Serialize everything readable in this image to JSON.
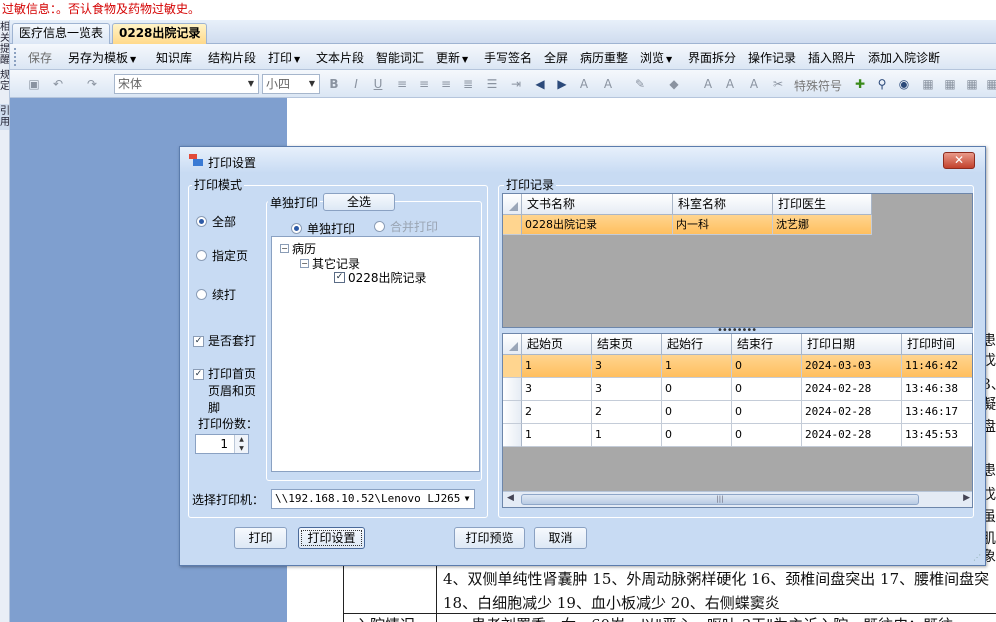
{
  "allergy_banner": "过敏信息：。否认食物及药物过敏史。",
  "left_strip": {
    "tab1": "相关提醒",
    "tab2": "规定",
    "tab3": "引用"
  },
  "doc_tabs": [
    "医疗信息一览表",
    "0228出院记录"
  ],
  "menubar": {
    "items": [
      {
        "label": "保存",
        "disabled": true
      },
      {
        "label": "另存为模板",
        "dropdown": true
      },
      {
        "label": "知识库"
      },
      {
        "label": "结构片段"
      },
      {
        "label": "打印",
        "dropdown": true
      },
      {
        "label": "文本片段"
      },
      {
        "label": "智能词汇"
      },
      {
        "label": "更新",
        "dropdown": true
      },
      {
        "label": "手写签名"
      },
      {
        "label": "全屏"
      },
      {
        "label": "病历重整"
      },
      {
        "label": "浏览",
        "dropdown": true
      },
      {
        "label": "界面拆分"
      },
      {
        "label": "操作记录"
      },
      {
        "label": "插入照片"
      },
      {
        "label": "添加入院诊断"
      }
    ]
  },
  "toolbar": {
    "font_name": "宋体",
    "font_size": "小四",
    "special_symbol": "特殊符号"
  },
  "document": {
    "line1": "4、双侧单纯性肾囊肿 15、外周动脉粥样硬化 16、颈椎间盘突出 17、腰椎间盘突",
    "line2": "18、白细胞减少 19、血小板减少 20、右侧蝶窦炎",
    "line3_label": "入院情况",
    "line3": "患者刘署秀，女，60岁，以\"恶心、呕吐 3天\"为主诉入院。既往史：既往",
    "edge_chars": [
      "患",
      "戊",
      "3、",
      "凝",
      "盘",
      "患",
      "戊",
      "虽",
      "肌",
      "象"
    ]
  },
  "dialog": {
    "title": "打印设置",
    "close_label": "✕",
    "print_mode": {
      "group_title": "打印模式",
      "options": [
        "全部",
        "指定页",
        "续打"
      ],
      "selected": "全部",
      "checkbox_overlay": "是否套打",
      "checkbox_header_footer": "打印首页页眉和页脚",
      "copies_label": "打印份数：",
      "copies_value": "1",
      "printer_label": "选择打印机："
    },
    "single_print": {
      "group_title": "单独打印",
      "select_all": "全选",
      "radio_single": "单独打印",
      "radio_merge": "合并打印",
      "tree": {
        "root": "病历",
        "child": "其它记录",
        "leaf": "0228出院记录"
      }
    },
    "printer_value": "\\\\192.168.10.52\\Lenovo LJ2655DN",
    "buttons": {
      "print": "打印",
      "print_settings": "打印设置",
      "print_preview": "打印预览",
      "cancel": "取消"
    },
    "print_records": {
      "group_title": "打印记录",
      "columns": [
        "文书名称",
        "科室名称",
        "打印医生"
      ],
      "rows": [
        [
          "0228出院记录",
          "内一科",
          "沈艺娜"
        ]
      ]
    },
    "page_records": {
      "columns": [
        "起始页",
        "结束页",
        "起始行",
        "结束行",
        "打印日期",
        "打印时间"
      ],
      "rows": [
        [
          "1",
          "3",
          "1",
          "0",
          "2024-03-03",
          "11:46:42"
        ],
        [
          "3",
          "3",
          "0",
          "0",
          "2024-02-28",
          "13:46:38"
        ],
        [
          "2",
          "2",
          "0",
          "0",
          "2024-02-28",
          "13:46:17"
        ],
        [
          "1",
          "1",
          "0",
          "0",
          "2024-02-28",
          "13:45:53"
        ]
      ]
    }
  }
}
